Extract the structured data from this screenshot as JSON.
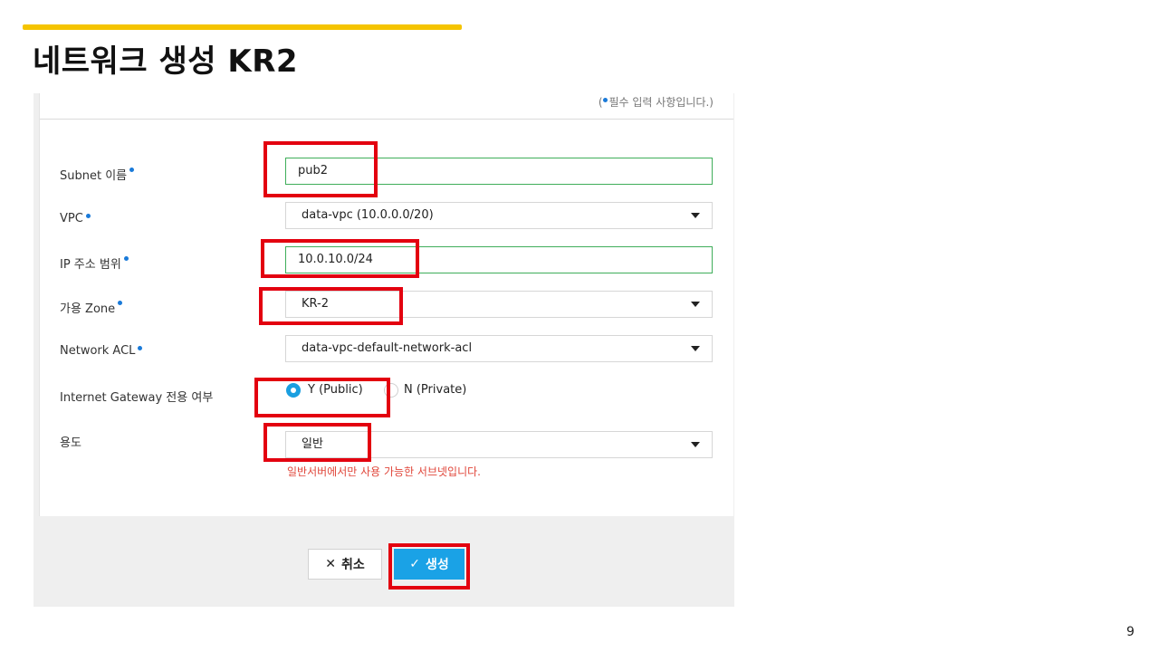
{
  "slide": {
    "title": "네트워크 생성 KR2",
    "page_number": "9"
  },
  "form": {
    "required_note_open": "(",
    "required_note_text": "필수 입력 사항입니다.)",
    "required_dot_color": "#1a7ad9",
    "fields": {
      "subnet_name": {
        "label": "Subnet 이름",
        "value": "pub2"
      },
      "vpc": {
        "label": "VPC",
        "value": "data-vpc (10.0.0.0/20)"
      },
      "ip_range": {
        "label": "IP 주소 범위",
        "value": "10.0.10.0/24"
      },
      "zone": {
        "label": "가용 Zone",
        "value": "KR-2"
      },
      "network_acl": {
        "label": "Network ACL",
        "value": "data-vpc-default-network-acl"
      },
      "internet_gateway": {
        "label": "Internet Gateway 전용 여부",
        "options": [
          "Y (Public)",
          "N (Private)"
        ],
        "selected": "Y (Public)"
      },
      "usage": {
        "label": "용도",
        "value": "일반",
        "hint": "일반서버에서만 사용 가능한 서브넷입니다."
      }
    }
  },
  "buttons": {
    "cancel_label": "취소",
    "cancel_icon": "close-icon",
    "create_label": "생성",
    "create_icon": "check-icon"
  },
  "colors": {
    "accent_bar": "#f5c400",
    "highlight_box": "#e3000f",
    "primary_button": "#1aa2e6",
    "valid_border": "#3fae5a",
    "hint_text": "#e0463a"
  }
}
